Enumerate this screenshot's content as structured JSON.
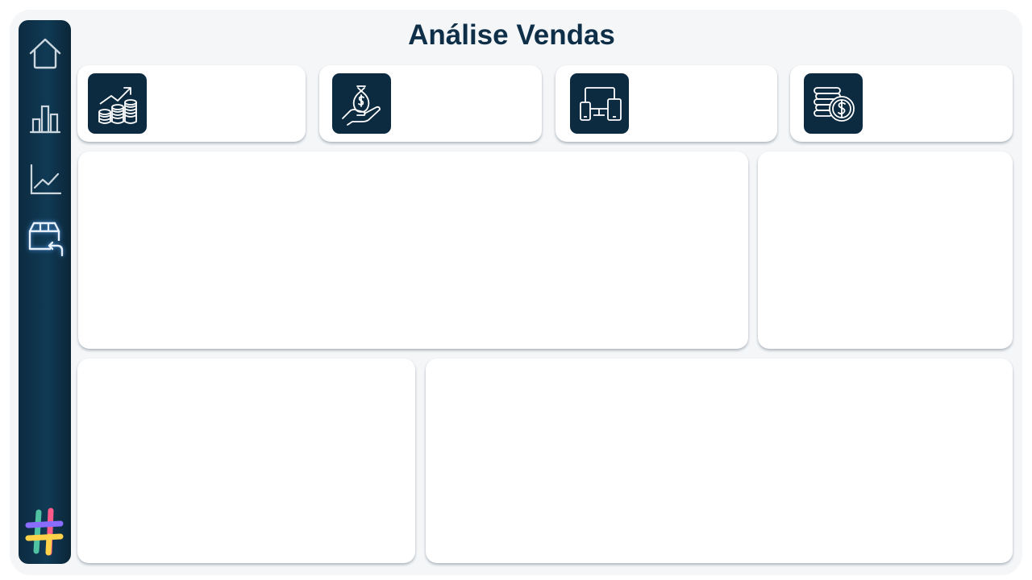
{
  "page": {
    "title": "Análise Vendas"
  },
  "sidebar": {
    "items": [
      {
        "name": "home",
        "icon": "home-icon"
      },
      {
        "name": "bar-chart",
        "icon": "bar-chart-icon"
      },
      {
        "name": "line-chart",
        "icon": "line-chart-icon"
      },
      {
        "name": "returns",
        "icon": "box-return-icon",
        "active": true
      }
    ],
    "logo_icon": "hashtag-logo-icon"
  },
  "kpis": [
    {
      "icon": "growth-coins-icon"
    },
    {
      "icon": "money-bag-hand-icon"
    },
    {
      "icon": "devices-icon"
    },
    {
      "icon": "coin-stack-icon"
    }
  ],
  "colors": {
    "sidebar": "#0c2b40",
    "title": "#0e2f47",
    "background": "#f4f6f8",
    "card": "#ffffff",
    "active_glow": "#5da8ff"
  }
}
